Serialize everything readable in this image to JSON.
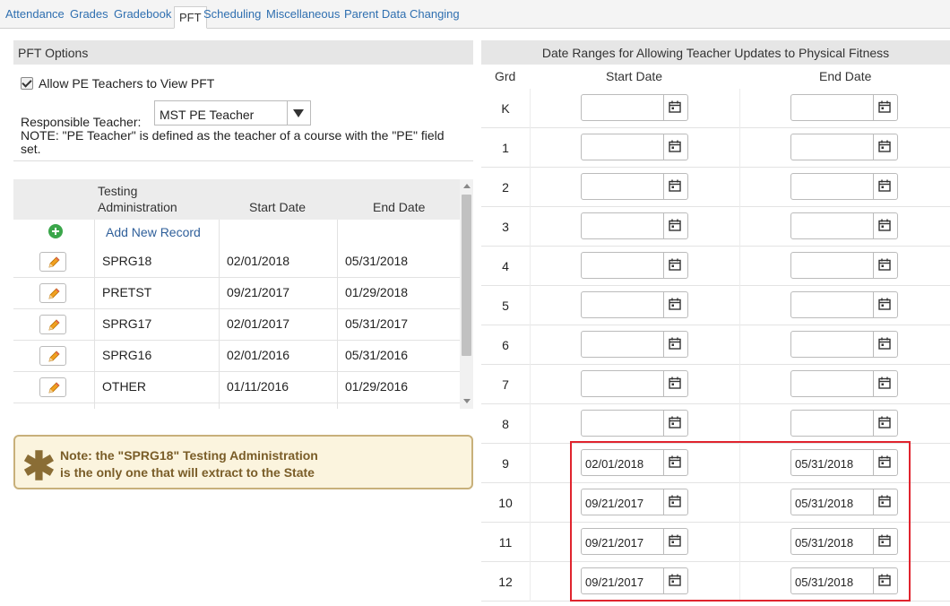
{
  "tabs": [
    {
      "label": "Attendance",
      "active": false
    },
    {
      "label": "Grades",
      "active": false
    },
    {
      "label": "Gradebook",
      "active": false
    },
    {
      "label": "PFT",
      "active": true
    },
    {
      "label": "Scheduling",
      "active": false
    },
    {
      "label": "Miscellaneous",
      "active": false
    },
    {
      "label": "Parent Data Changing",
      "active": false
    }
  ],
  "pft_options": {
    "title": "PFT Options",
    "allow_label": "Allow PE Teachers to View PFT",
    "allow_checked": true,
    "responsible_label": "Responsible Teacher:",
    "responsible_value": "MST PE Teacher",
    "note": "NOTE: \"PE Teacher\" is defined as the teacher of a course with the \"PE\" field set."
  },
  "testing_grid": {
    "headers": {
      "admin_line1": "Testing",
      "admin_line2": "Administration",
      "start": "Start Date",
      "end": "End Date"
    },
    "add_label": "Add New Record",
    "rows": [
      {
        "admin": "SPRG18",
        "start": "02/01/2018",
        "end": "05/31/2018"
      },
      {
        "admin": "PRETST",
        "start": "09/21/2017",
        "end": "01/29/2018"
      },
      {
        "admin": "SPRG17",
        "start": "02/01/2017",
        "end": "05/31/2017"
      },
      {
        "admin": "SPRG16",
        "start": "02/01/2016",
        "end": "05/31/2016"
      },
      {
        "admin": "OTHER",
        "start": "01/11/2016",
        "end": "01/29/2016"
      }
    ]
  },
  "notice": {
    "line1": "Note: the \"SPRG18\" Testing Administration",
    "line2": "is the only one that will extract to the State"
  },
  "date_ranges": {
    "title": "Date Ranges for Allowing Teacher Updates to Physical Fitness",
    "headers": {
      "grade": "Grd",
      "start": "Start Date",
      "end": "End Date"
    },
    "rows": [
      {
        "grade": "K",
        "start": "",
        "end": ""
      },
      {
        "grade": "1",
        "start": "",
        "end": ""
      },
      {
        "grade": "2",
        "start": "",
        "end": ""
      },
      {
        "grade": "3",
        "start": "",
        "end": ""
      },
      {
        "grade": "4",
        "start": "",
        "end": ""
      },
      {
        "grade": "5",
        "start": "",
        "end": ""
      },
      {
        "grade": "6",
        "start": "",
        "end": ""
      },
      {
        "grade": "7",
        "start": "",
        "end": ""
      },
      {
        "grade": "8",
        "start": "",
        "end": ""
      },
      {
        "grade": "9",
        "start": "02/01/2018",
        "end": "05/31/2018"
      },
      {
        "grade": "10",
        "start": "09/21/2017",
        "end": "05/31/2018"
      },
      {
        "grade": "11",
        "start": "09/21/2017",
        "end": "05/31/2018"
      },
      {
        "grade": "12",
        "start": "09/21/2017",
        "end": "05/31/2018"
      }
    ]
  },
  "colors": {
    "link": "#2f6fb0",
    "highlight": "#e0242e",
    "note_bg": "#fbf4de",
    "add_green": "#3aa64a"
  }
}
